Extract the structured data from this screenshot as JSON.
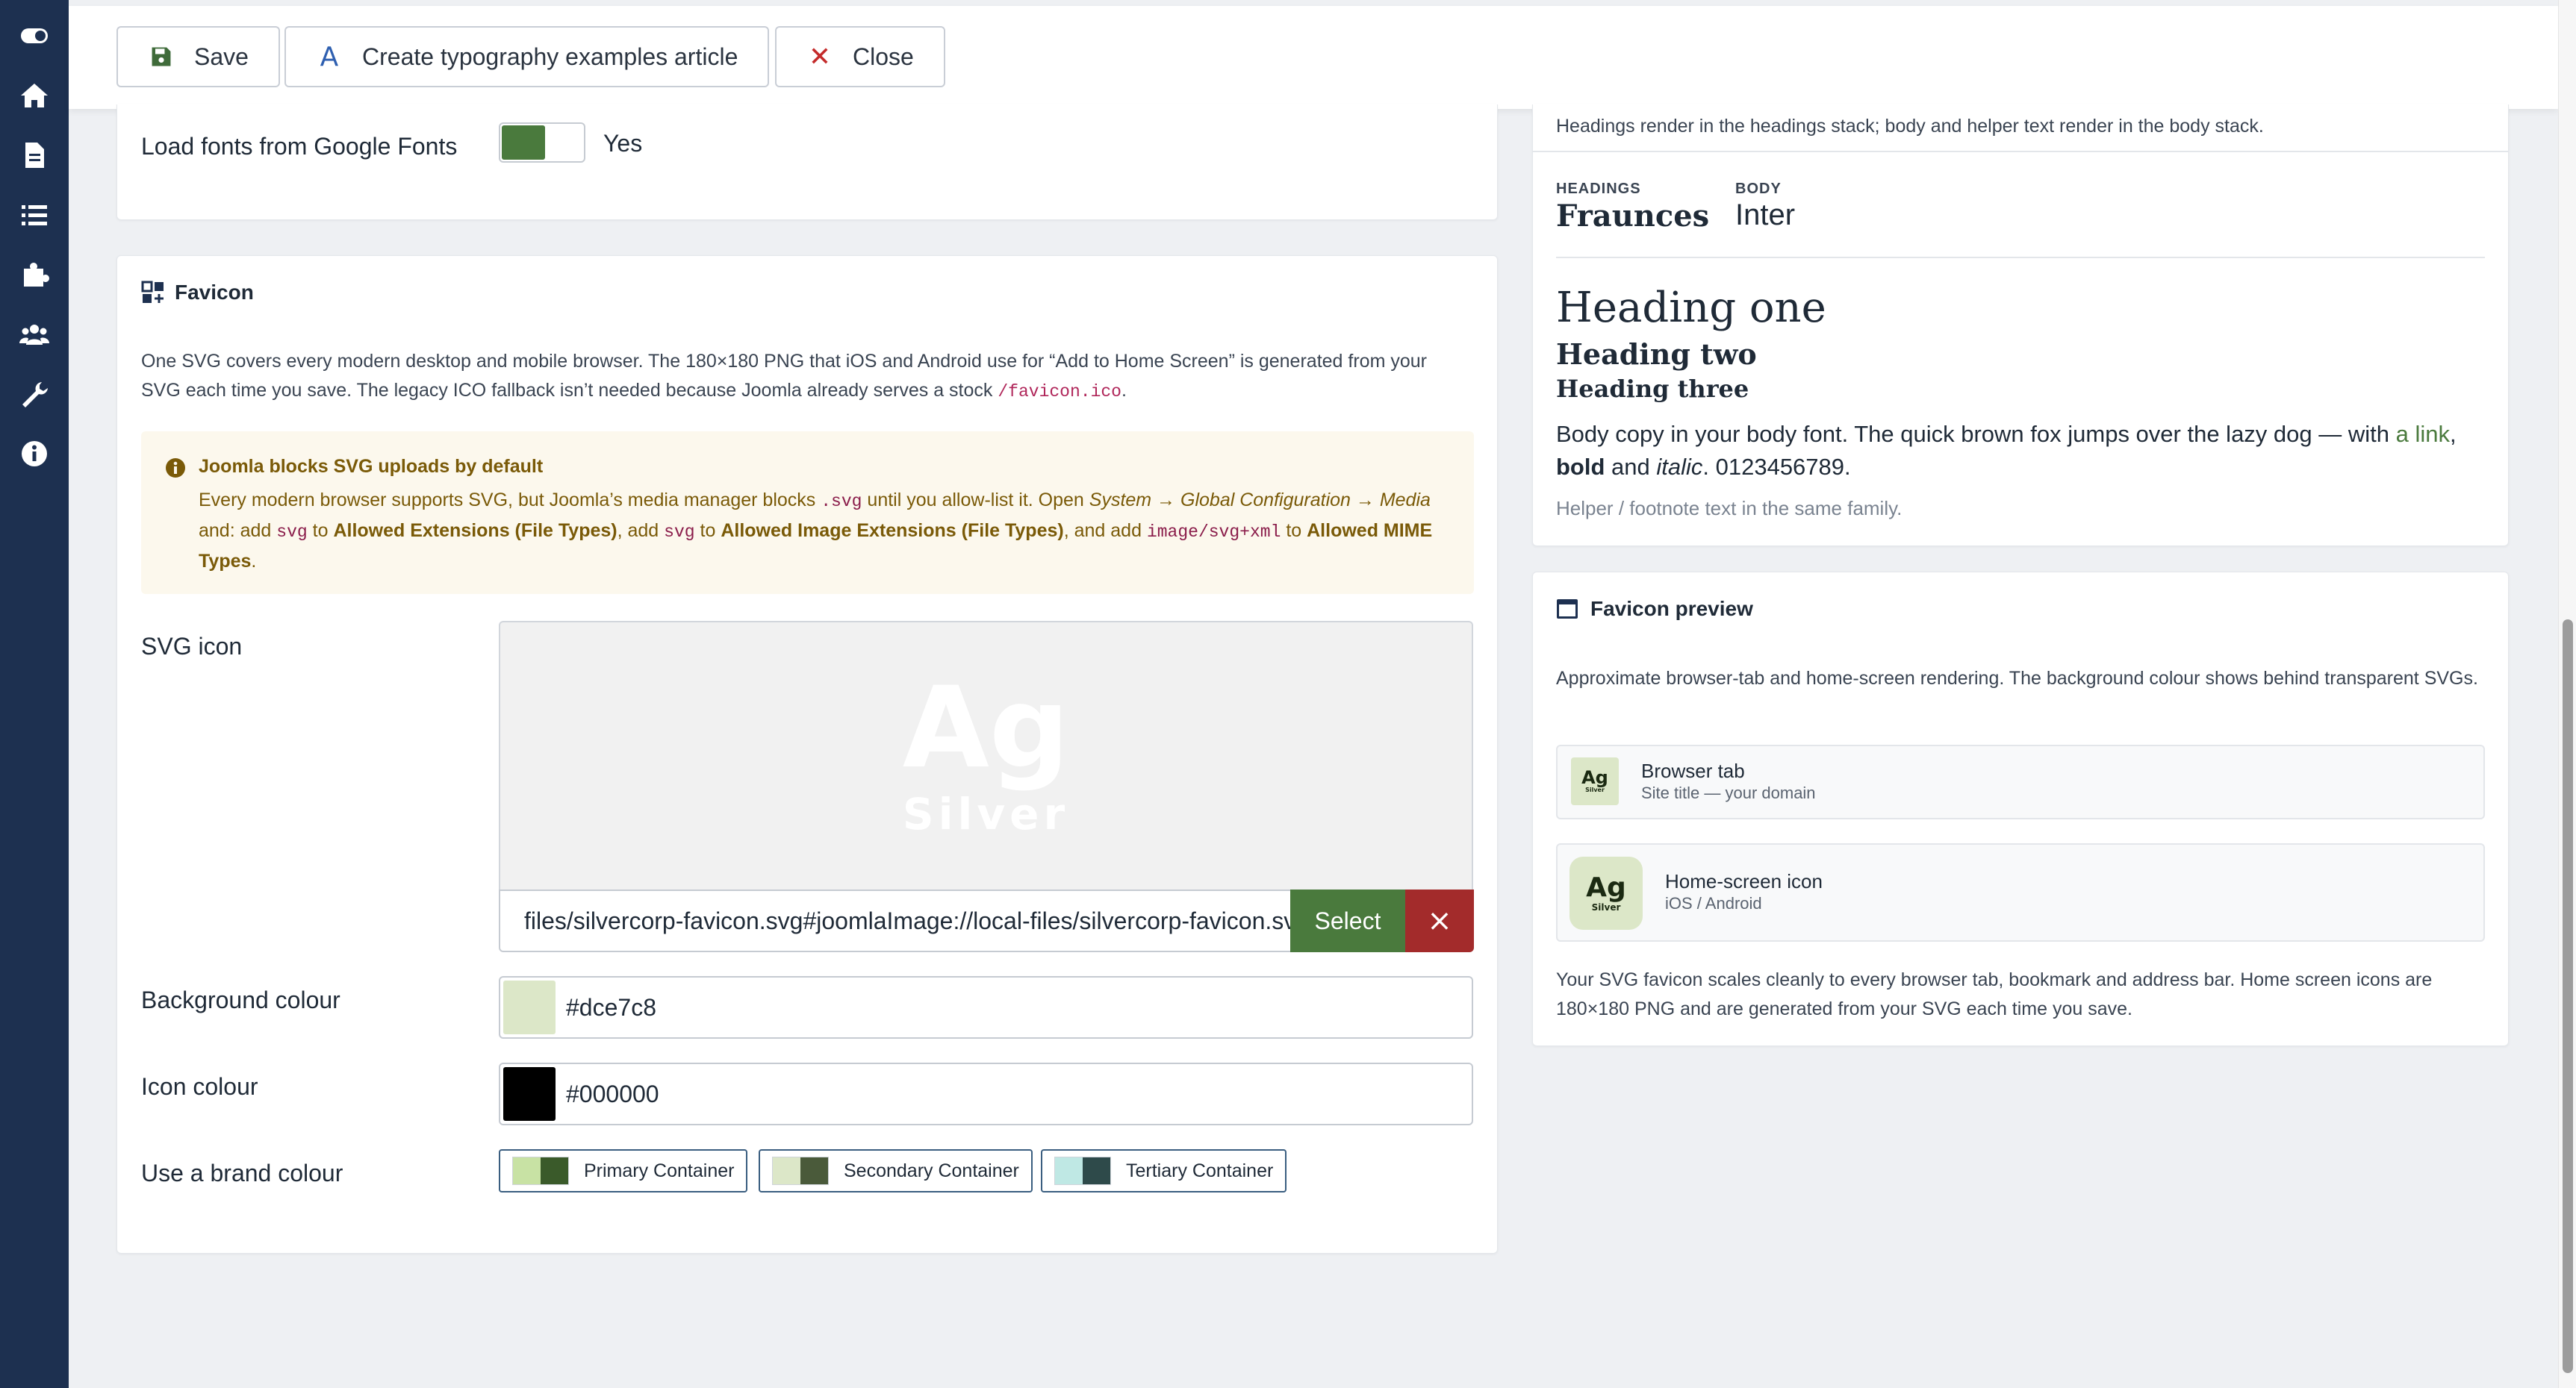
{
  "toolbar": {
    "save": "Save",
    "create_article": "Create typography examples article",
    "close": "Close"
  },
  "typography": {
    "google_fonts_label": "Load fonts from Google Fonts",
    "google_fonts_value": "Yes",
    "preview_note": "Headings render in the headings stack; body and helper text render in the body stack.",
    "headings_caption": "HEADINGS",
    "headings_font": "Fraunces",
    "body_caption": "BODY",
    "body_font": "Inter",
    "heading_one": "Heading one",
    "heading_two": "Heading two",
    "heading_three": "Heading three",
    "body_text_1": "Body copy in your body font. The quick brown fox jumps over the lazy dog — with ",
    "body_link": "a link",
    "body_sep": ", ",
    "body_bold": "bold",
    "body_and": " and ",
    "body_italic": "italic",
    "body_end": ". 0123456789.",
    "helper_text": "Helper / footnote text in the same family."
  },
  "favicon": {
    "title": "Favicon",
    "desc_1": "One SVG covers every modern desktop and mobile browser. The 180×180 PNG that iOS and Android use for “Add to Home Screen” is generated from your",
    "desc_2": "SVG each time you save. The legacy ICO fallback isn’t needed because Joomla already serves a stock ",
    "desc_code": "/favicon.ico",
    "desc_end": ".",
    "notice_title": "Joomla blocks SVG uploads by default",
    "notice_1a": "Every modern browser supports SVG, but Joomla’s media manager blocks ",
    "notice_1code": ".svg",
    "notice_1b": " until you allow-list it. Open ",
    "notice_1path": "System → Global Configuration → Media",
    "notice_2a": "and: add ",
    "notice_2code1": "svg",
    "notice_2b": " to ",
    "notice_2bold1": "Allowed Extensions (File Types)",
    "notice_2c": ", add ",
    "notice_2code2": "svg",
    "notice_2d": " to ",
    "notice_2bold2": "Allowed Image Extensions (File Types)",
    "notice_2e": ", and add ",
    "notice_2code3": "image/svg+xml",
    "notice_2f": " to ",
    "notice_2bold3a": "Allowed MIME",
    "notice_3bold": "Types",
    "notice_3end": ".",
    "svg_label": "SVG icon",
    "svg_preview_main": "Ag",
    "svg_preview_sub": "Silver",
    "svg_value": "files/silvercorp-favicon.svg#joomlaImage://local-files/silvercorp-favicon.svg",
    "select_label": "Select",
    "clear_label": "×",
    "bg_label": "Background colour",
    "bg_value": "#dce7c8",
    "icon_label": "Icon colour",
    "icon_value": "#000000",
    "brand_label": "Use a brand colour",
    "brand_chips": [
      {
        "label": "Primary Container",
        "c1": "#c8e2a4",
        "c2": "#3a5a2a"
      },
      {
        "label": "Secondary Container",
        "c1": "#dce7c8",
        "c2": "#4a5a3a"
      },
      {
        "label": "Tertiary Container",
        "c1": "#bfe8e4",
        "c2": "#2e4a4a"
      }
    ]
  },
  "favicon_preview": {
    "title": "Favicon preview",
    "desc": "Approximate browser-tab and home-screen rendering. The background colour shows behind transparent SVGs.",
    "tab_title": "Browser tab",
    "tab_sub": "Site title — your domain",
    "home_title": "Home-screen icon",
    "home_sub": "iOS / Android",
    "tile_main": "Ag",
    "tile_sub": "Silver",
    "footer": "Your SVG favicon scales cleanly to every browser tab, bookmark and address bar. Home screen icons are 180×180 PNG and are generated from your SVG each time you save."
  },
  "colors": {
    "sidebar": "#1d3050",
    "accent_green": "#4a7a3d",
    "danger": "#a32b2b",
    "icon_bg": "#dce7c8"
  }
}
